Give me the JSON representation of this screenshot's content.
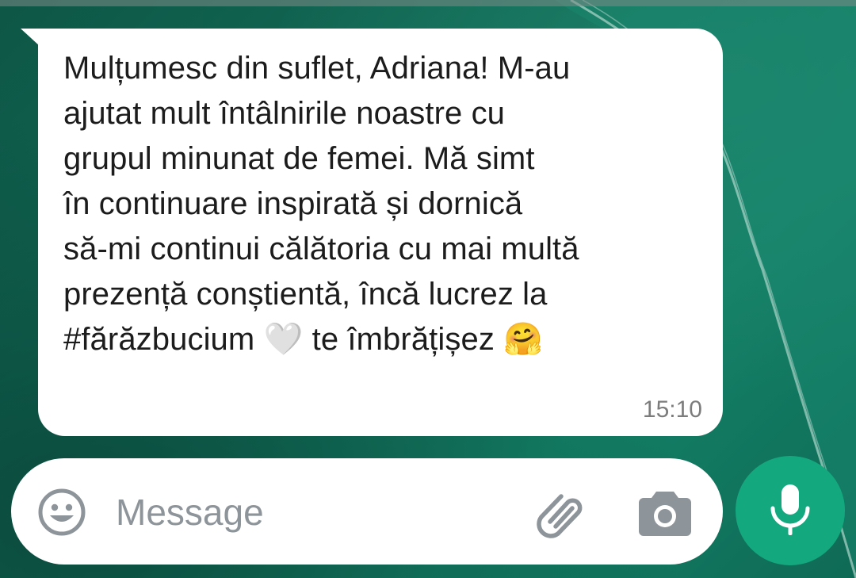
{
  "chat": {
    "message": {
      "text": "Mulțumesc din suflet, Adriana! M-au\najutat mult întâlnirile noastre cu\ngrupul minunat de femei. Mă simt\nîn continuare inspirată și dornică\nsă-mi continui călătoria cu mai multă\nprezență conștientă, încă lucrez la\n#fărăzbucium 🤍 te îmbrățișez 🤗",
      "time": "15:10",
      "direction": "incoming"
    }
  },
  "composer": {
    "placeholder": "Message",
    "icons": {
      "emoji": "smiley-face-icon",
      "attach": "paperclip-icon",
      "camera": "camera-icon",
      "mic": "microphone-icon"
    }
  },
  "colors": {
    "wallpaper": "#0f5a4a",
    "bubble": "#ffffff",
    "accent": "#14a87f",
    "icon_gray": "#8d949a",
    "timestamp": "#7c7c7c"
  }
}
